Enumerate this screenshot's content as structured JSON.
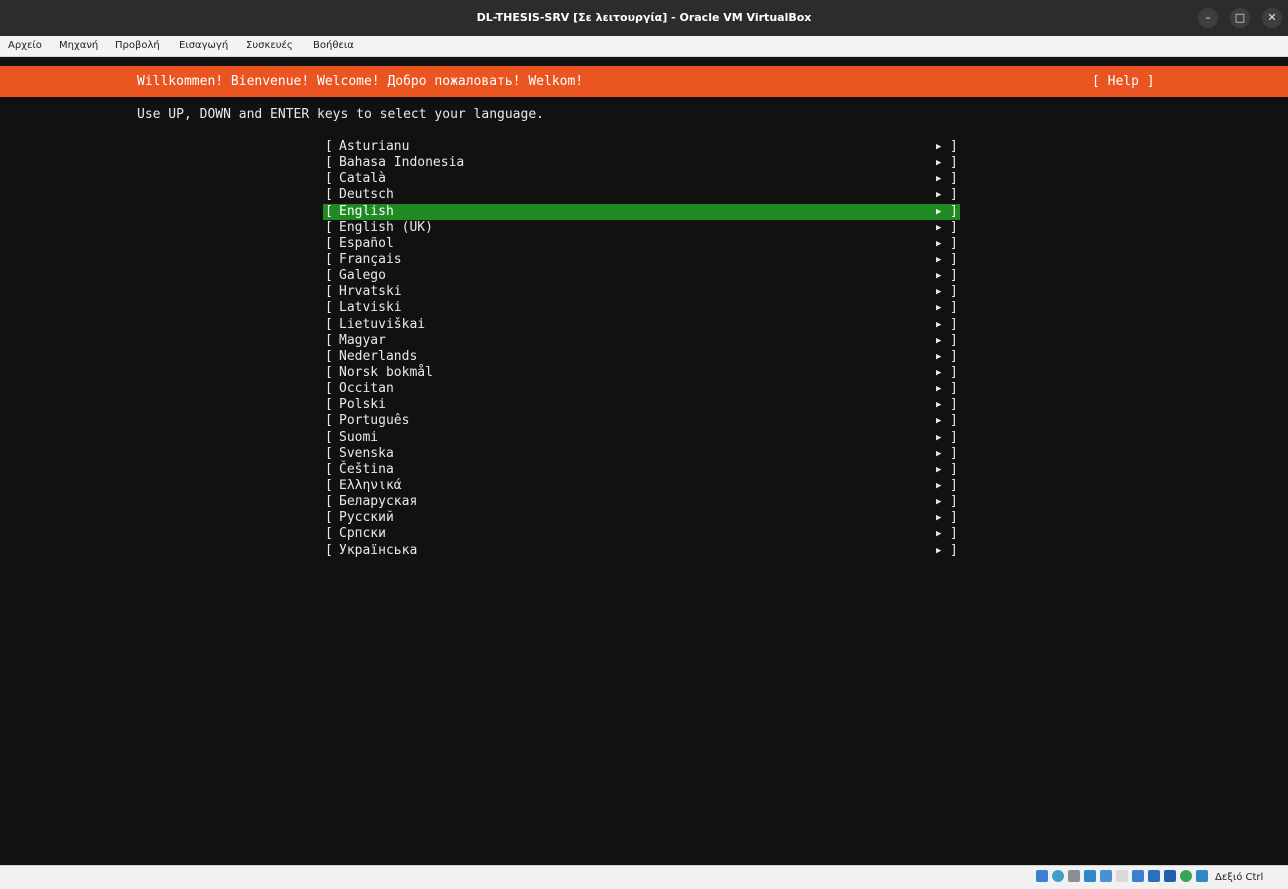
{
  "window": {
    "title": "DL-THESIS-SRV [Σε λειτουργία] - Oracle VM VirtualBox",
    "minimize_glyph": "–",
    "maximize_glyph": "□",
    "close_glyph": "✕"
  },
  "menu": [
    "Αρχείο",
    "Μηχανή",
    "Προβολή",
    "Εισαγωγή",
    "Συσκευές",
    "Βοήθεια"
  ],
  "installer": {
    "header": "Willkommen! Bienvenue! Welcome! Добро пожаловать! Welkom!",
    "help_label": "[ Help ]",
    "instruction": "Use UP, DOWN and ENTER keys to select your language.",
    "selected_index": 4,
    "languages": [
      "Asturianu",
      "Bahasa Indonesia",
      "Català",
      "Deutsch",
      "English",
      "English (UK)",
      "Español",
      "Français",
      "Galego",
      "Hrvatski",
      "Latviski",
      "Lietuviškai",
      "Magyar",
      "Nederlands",
      "Norsk bokmål",
      "Occitan",
      "Polski",
      "Português",
      "Suomi",
      "Svenska",
      "Čeština",
      "Ελληνικά",
      "Беларуская",
      "Русский",
      "Српски",
      "Українська"
    ],
    "left_bracket": "[",
    "right_bracket": "]",
    "arrow_glyph": "▶"
  },
  "colors": {
    "header_bg": "#e95420",
    "selected_bg": "#1e8a21",
    "console_bg": "#111111"
  },
  "statusbar": {
    "icons": [
      "hard-disk-icon",
      "optical-drive-icon",
      "audio-icon",
      "network-icon",
      "usb-icon",
      "shared-folders-icon",
      "display-icon",
      "video-capture-icon",
      "recording-icon",
      "cpu-icon",
      "mouse-integration-icon"
    ],
    "host_key": "Δεξιό Ctrl"
  }
}
